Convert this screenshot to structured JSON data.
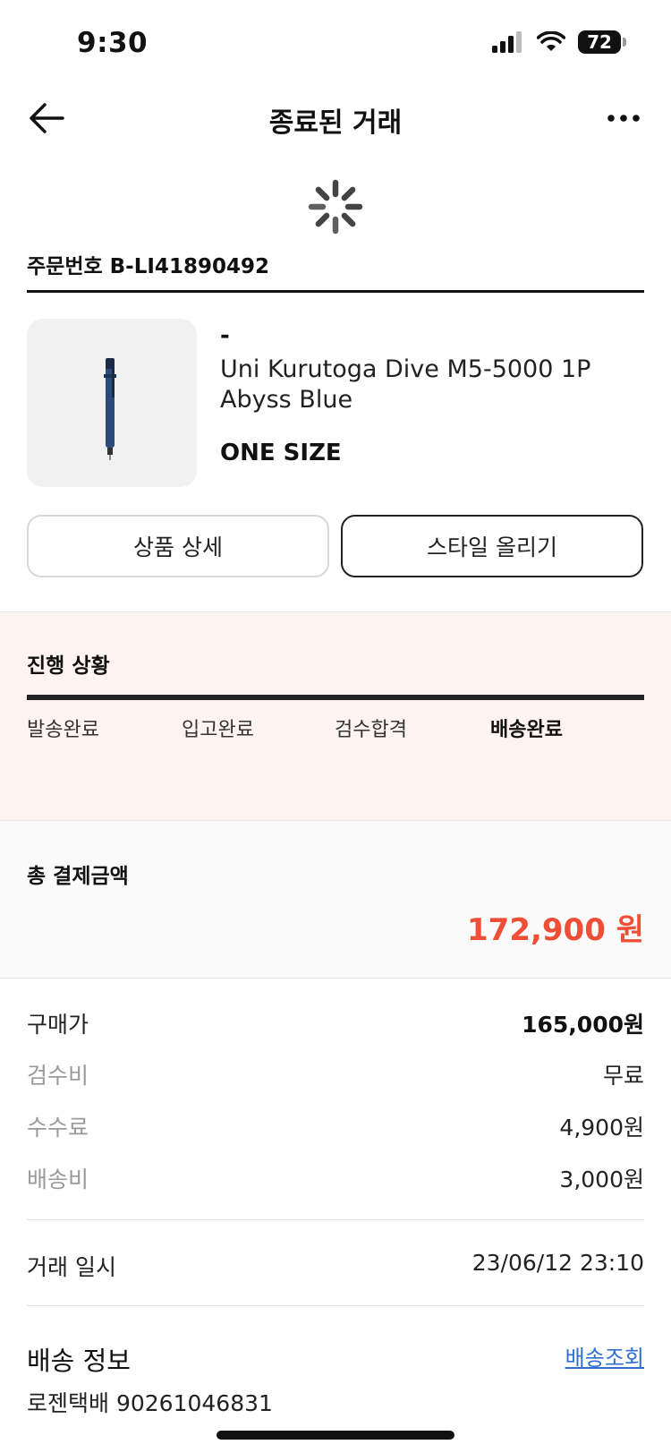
{
  "status_bar": {
    "time": "9:30",
    "battery": "72",
    "icons": [
      "signal-icon",
      "wifi-icon",
      "battery-icon"
    ]
  },
  "nav": {
    "title": "종료된 거래",
    "back_icon": "back-arrow-icon",
    "more_icon": "more-icon"
  },
  "order": {
    "number": "주문번호 B-LI41890492"
  },
  "product": {
    "dash": "-",
    "name": "Uni Kurutoga Dive M5-5000 1P Abyss Blue",
    "size": "ONE SIZE",
    "image_icon": "pen-image"
  },
  "actions": {
    "detail_label": "상품 상세",
    "style_label": "스타일 올리기"
  },
  "progress": {
    "title": "진행 상황",
    "steps": [
      "발송완료",
      "입고완료",
      "검수합격",
      "배송완료"
    ],
    "active_step": 3,
    "fraction": 1.0
  },
  "total": {
    "label": "총 결제금액",
    "amount": "172,900 원",
    "color": "#ef4e37"
  },
  "fees": [
    {
      "label": "구매가",
      "value": "165,000원"
    },
    {
      "label": "검수비",
      "value": "무료"
    },
    {
      "label": "수수료",
      "value": "4,900원"
    },
    {
      "label": "배송비",
      "value": "3,000원"
    }
  ],
  "trade": {
    "label": "거래 일시",
    "value": "23/06/12 23:10"
  },
  "shipping": {
    "title": "배송 정보",
    "track_label": "배송조회",
    "carrier": "로젠택배 90261046831",
    "link_color": "#2f6fd1"
  }
}
